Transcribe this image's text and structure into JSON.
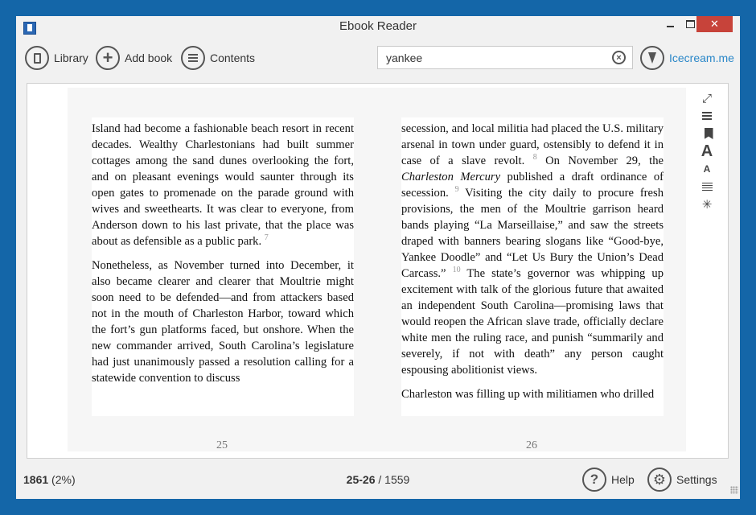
{
  "window": {
    "title": "Ebook Reader",
    "close_label": "✕",
    "accent_color": "#2a87c8",
    "close_color": "#c7433a"
  },
  "toolbar": {
    "library_label": "Library",
    "add_book_label": "Add book",
    "contents_label": "Contents",
    "search": {
      "value": "yankee",
      "placeholder": ""
    },
    "brand_label": "Icecream.me"
  },
  "reader": {
    "left_page": {
      "paragraphs": [
        {
          "text": "Island had become a fashionable beach resort in recent decades. Wealthy Charlestonians had built summer cottages among the sand dunes overlooking the fort, and on pleasant evenings would saunter through its open gates to promenade on the parade ground with wives and sweethearts. It was clear to everyone, from Anderson down to his last private, that the place was about as defensible as a public park.",
          "note": "7"
        },
        {
          "text": "Nonetheless, as November turned into December, it also became clearer and clearer that Moultrie might soon need to be defended—and from attackers based not in the mouth of Charleston Harbor, toward which the fort’s gun platforms faced, but onshore. When the new commander arrived, South Carolina’s legislature had just unanimously passed a resolution calling for a statewide convention to discuss"
        }
      ],
      "page_number": "25"
    },
    "right_page": {
      "p1": {
        "s1": "secession, and local militia had placed the U.S. military arsenal in town under guard, ostensibly to defend it in case of a slave revolt.",
        "n1": "8",
        "s2": " On November 29, the ",
        "italic": "Charleston Mercury",
        "s3": " published a draft ordinance of secession.",
        "n2": "9",
        "s4": " Visiting the city daily to procure fresh provisions, the men of the Moultrie garrison heard bands playing “La Marseillaise,” and saw the streets draped with banners bearing slogans like “Good-bye, Yankee Doodle” and “Let Us Bury the Union’s Dead Carcass.”",
        "n3": "10",
        "s5": " The state’s governor was whipping up excitement with talk of the glorious future that awaited an independent South Carolina—promising laws that would reopen the African slave trade, officially declare white men the ruling race, and punish “summarily and severely, if not with death” any person caught espousing abolitionist views."
      },
      "p2": "Charleston was filling up with militiamen who drilled",
      "page_number": "26"
    }
  },
  "statusbar": {
    "position": "1861",
    "percent": "(2%)",
    "current_pages": "25-26",
    "total_pages": "/ 1559",
    "help_label": "Help",
    "settings_label": "Settings"
  }
}
